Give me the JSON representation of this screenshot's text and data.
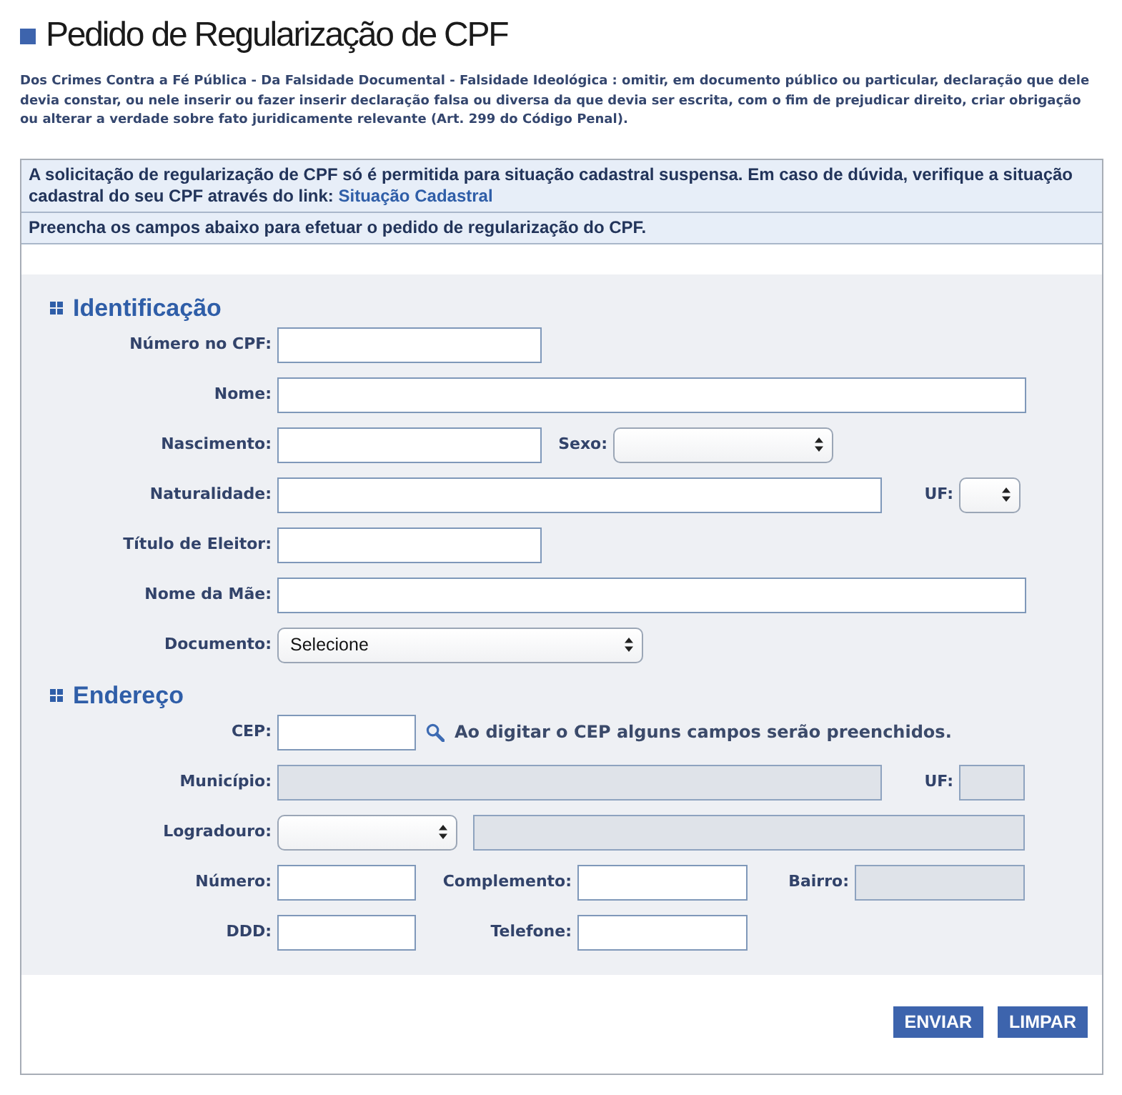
{
  "page": {
    "title": "Pedido de Regularização de CPF",
    "legal_notice": "Dos Crimes Contra a Fé Pública - Da Falsidade Documental - Falsidade Ideológica : omitir, em documento público ou particular, declaração que dele devia constar, ou nele inserir ou fazer inserir declaração falsa ou diversa da que devia ser escrita, com o fim de prejudicar direito, criar obrigação ou alterar a verdade sobre fato juridicamente relevante (Art. 299 do Código Penal)."
  },
  "notices": [
    {
      "text": "A solicitação de regularização de CPF só é permitida para situação cadastral suspensa. Em caso de dúvida, verifique a situação cadastral do seu CPF através do link:",
      "link": "Situação Cadastral"
    },
    {
      "text": "Preencha os campos abaixo para efetuar o pedido de regularização do CPF."
    }
  ],
  "sections": [
    {
      "title": "Identificação",
      "rows": [
        {
          "fields": [
            {
              "label": "Número no CPF:",
              "kind": "text",
              "disabled": false
            }
          ]
        },
        {
          "fields": [
            {
              "label": "Nome:",
              "kind": "text",
              "disabled": false
            }
          ]
        },
        {
          "fields": [
            {
              "label": "Nascimento:",
              "kind": "text",
              "disabled": false
            },
            {
              "label": "Sexo:",
              "kind": "select",
              "disabled": false
            }
          ]
        },
        {
          "fields": [
            {
              "label": "Naturalidade:",
              "kind": "text",
              "disabled": false
            },
            {
              "label": "UF:",
              "kind": "select",
              "disabled": false
            }
          ]
        },
        {
          "fields": [
            {
              "label": "Título de Eleitor:",
              "kind": "text",
              "disabled": false
            }
          ]
        },
        {
          "fields": [
            {
              "label": "Nome da Mãe:",
              "kind": "text",
              "disabled": false
            }
          ]
        },
        {
          "fields": [
            {
              "label": "Documento:",
              "kind": "select",
              "value": "Selecione",
              "disabled": false
            }
          ]
        }
      ]
    },
    {
      "title": "Endereço",
      "rows": [
        {
          "fields": [
            {
              "label": "CEP:",
              "kind": "text",
              "disabled": false
            }
          ],
          "hint": "Ao digitar o CEP alguns campos serão preenchidos."
        },
        {
          "fields": [
            {
              "label": "Município:",
              "kind": "text",
              "disabled": true
            },
            {
              "label": "UF:",
              "kind": "text",
              "disabled": true
            }
          ]
        },
        {
          "fields": [
            {
              "label": "Logradouro:",
              "kind": "select",
              "disabled": false
            },
            {
              "kind": "text",
              "disabled": true
            }
          ]
        },
        {
          "fields": [
            {
              "label": "Número:",
              "kind": "text",
              "disabled": false
            },
            {
              "label": "Complemento:",
              "kind": "text",
              "disabled": false
            },
            {
              "label": "Bairro:",
              "kind": "text",
              "disabled": true
            }
          ]
        },
        {
          "fields": [
            {
              "label": "DDD:",
              "kind": "text",
              "disabled": false
            },
            {
              "label": "Telefone:",
              "kind": "text",
              "disabled": false
            }
          ]
        }
      ]
    }
  ],
  "buttons": [
    "ENVIAR",
    "LIMPAR"
  ]
}
